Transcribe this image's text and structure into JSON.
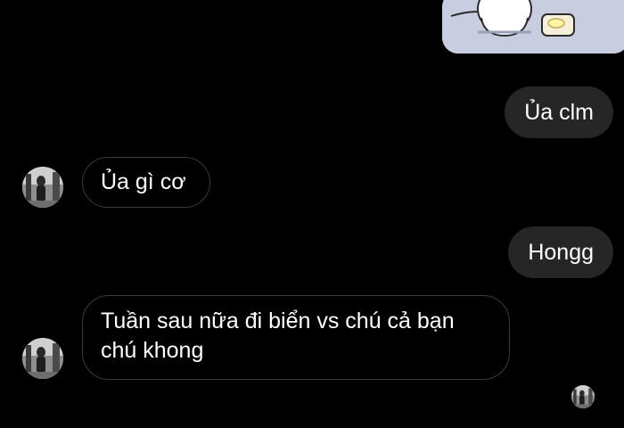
{
  "messages": [
    {
      "direction": "outgoing",
      "text": "Ủa clm"
    },
    {
      "direction": "incoming",
      "text": "Ủa gì cơ"
    },
    {
      "direction": "outgoing",
      "text": "Hongg"
    },
    {
      "direction": "incoming",
      "line1": "Tuần sau nữa đi biển vs chú cả bạn",
      "line2": "chú khong"
    }
  ],
  "icons": {
    "sticker": "sticker-image",
    "avatar": "contact-avatar",
    "seen": "seen-avatar-icon"
  },
  "colors": {
    "background": "#000000",
    "outgoing_bubble": "#262626",
    "incoming_border": "#3a3a3a",
    "text": "#ffffff"
  }
}
